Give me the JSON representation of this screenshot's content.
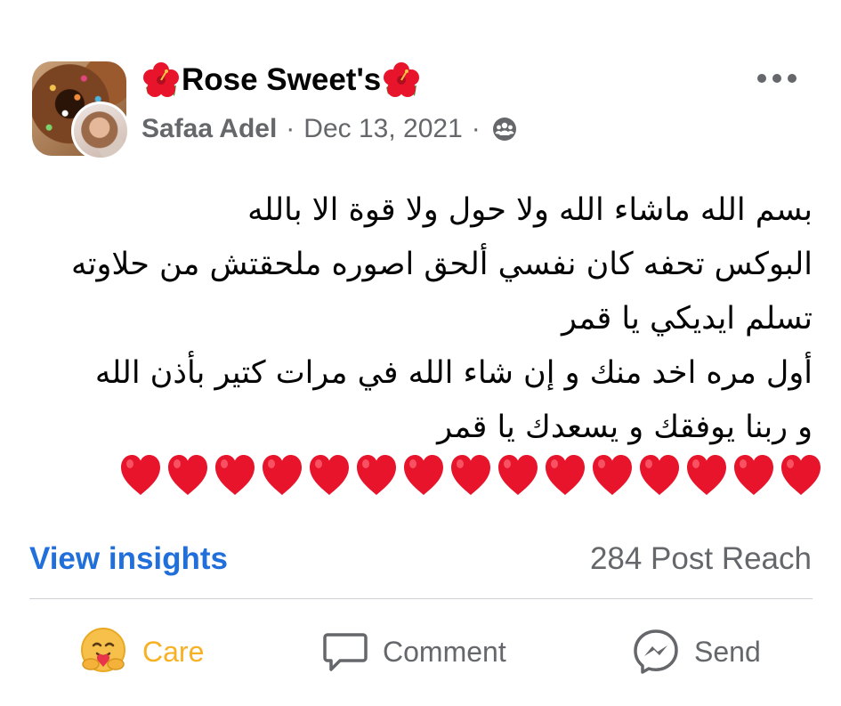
{
  "post": {
    "group_name": "Rose Sweet's",
    "author": "Safaa Adel",
    "date": "Dec 13, 2021",
    "separator": "·",
    "privacy_icon": "groups-icon",
    "lines": [
      "بسم الله ماشاء الله ولا حول ولا قوة الا بالله",
      "البوكس تحفه كان نفسي ألحق اصوره ملحقتش من حلاوته",
      "تسلم ايديكي يا قمر",
      "أول مره اخد منك و إن شاء الله في مرات كتير بأذن الله",
      "و ربنا يوفقك و يسعدك يا قمر"
    ],
    "heart_count": 15,
    "heart_color": "#e8142b"
  },
  "insights": {
    "link_label": "View insights",
    "reach_label": "284 Post Reach"
  },
  "actions": {
    "care_label": "Care",
    "comment_label": "Comment",
    "send_label": "Send"
  },
  "colors": {
    "link_blue": "#216fdb",
    "secondary_text": "#65676b",
    "care_yellow": "#f7b125"
  }
}
